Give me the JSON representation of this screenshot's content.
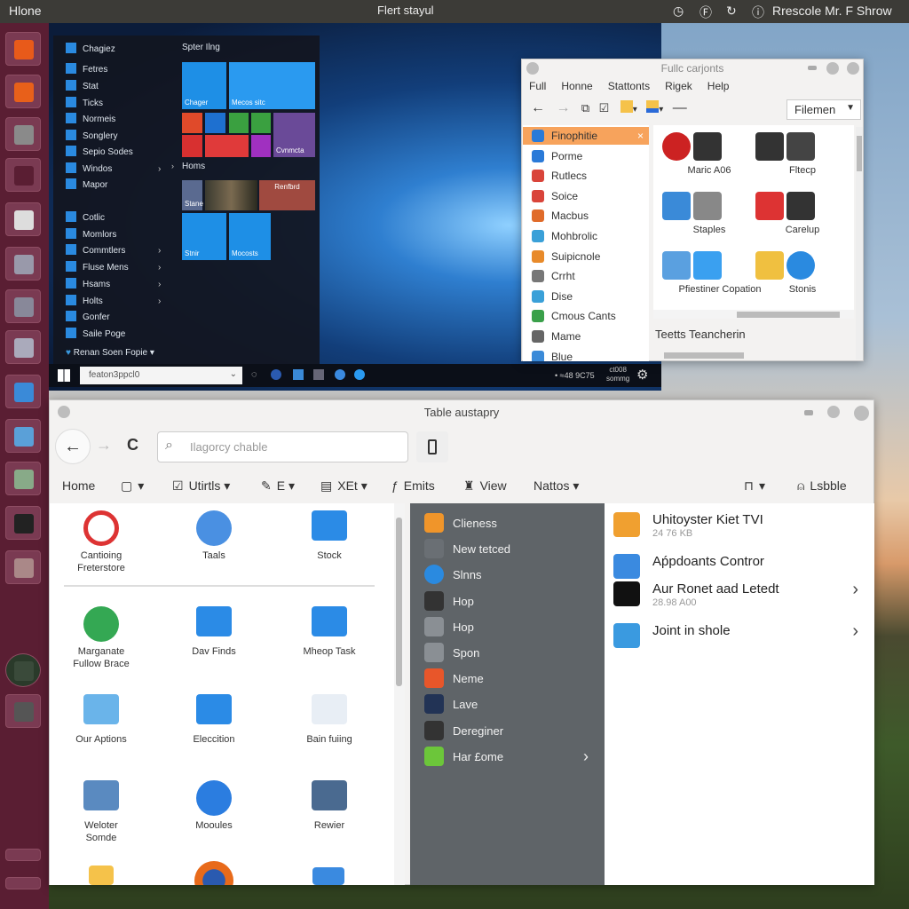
{
  "topbar": {
    "left": "Hlone",
    "center": "Flert stayul",
    "right": "Rrescole Mr. F Shrow",
    "icons": [
      "clock-icon",
      "f-icon",
      "refresh-icon",
      "info-icon"
    ]
  },
  "launcher": {
    "icons": [
      "settings-icon",
      "text-editor-icon",
      "search-icon",
      "flash-icon",
      "qr-icon",
      "cable-icon",
      "image-viewer-icon",
      "balloon-icon",
      "office-icon",
      "spreadsheet-icon",
      "disks-icon",
      "checkbox-icon",
      "network-icon",
      "clock-icon",
      "add-workspace-icon",
      "minimize-icon",
      "printer-icon"
    ]
  },
  "start_menu": {
    "items": [
      {
        "label": "Chagiez"
      },
      {
        "label": "Fetres"
      },
      {
        "label": "Stat"
      },
      {
        "label": "Ticks"
      },
      {
        "label": "Normeis"
      },
      {
        "label": "Songlery"
      },
      {
        "label": "Sepio Sodes"
      },
      {
        "label": "Windos",
        "arrow": true
      },
      {
        "label": "Mapor"
      },
      {
        "label": "Cotlic"
      },
      {
        "label": "Momlors"
      },
      {
        "label": "Commtlers",
        "arrow": true
      },
      {
        "label": "Fluse Mens",
        "arrow": true
      },
      {
        "label": "Hsams",
        "arrow": true
      },
      {
        "label": "Holts",
        "arrow": true
      },
      {
        "label": "Gonfer"
      },
      {
        "label": "Saile Poge"
      }
    ],
    "footer": "Renan Soen Fopie ▾",
    "group1": "Spter Ilng",
    "group2": "Homs",
    "tiles": [
      "Chager",
      "Mecos sitc",
      "Cvnmcta",
      "Stane",
      "Stnir",
      "Mocosts"
    ],
    "news_tile": "Renfbrd"
  },
  "taskbar": {
    "search": "featon3ppcl0",
    "tray_status": "• ≈48 9C75",
    "clock_top": "ct008",
    "clock_bottom": "sommg"
  },
  "file_window": {
    "title": "Fullc carjonts",
    "menu": [
      "Full",
      "Honne",
      "Stattonts",
      "Rigek",
      "Help"
    ],
    "dropdown": "Filemen",
    "sidebar": [
      {
        "label": "Finophitie",
        "color": "#2a7ad8"
      },
      {
        "label": "Porme",
        "color": "#2a7ad8"
      },
      {
        "label": "Rutlecs",
        "color": "#d9443a"
      },
      {
        "label": "Soice",
        "color": "#d9443a"
      },
      {
        "label": "Macbus",
        "color": "#e06b2a"
      },
      {
        "label": "Mohbrolic",
        "color": "#3aa0d8"
      },
      {
        "label": "Suipicnole",
        "color": "#e88a2a"
      },
      {
        "label": "Crrht",
        "color": "#777777"
      },
      {
        "label": "Dise",
        "color": "#3aa0d8"
      },
      {
        "label": "Cmous Cants",
        "color": "#3aa04a"
      },
      {
        "label": "Mame",
        "color": "#666666"
      },
      {
        "label": "Blue",
        "color": "#3a8ad8"
      }
    ],
    "selected_color": "#f7a35c",
    "grid": [
      "Maric A06",
      "Fltecp",
      "Staples",
      "Carelup",
      "Pfiestiner Copation",
      "Stonis"
    ],
    "footer": "Teetts Teancherin"
  },
  "main_window": {
    "title": "Table austapry",
    "search_placeholder": "Ilagorcy chable",
    "menu": [
      "Home",
      "▾",
      "Utirtls ▾",
      "E ▾",
      "XEt ▾",
      "Emits",
      "View",
      "Nattos ▾"
    ],
    "menu_right": [
      "▾",
      "Lsbble"
    ],
    "grid": [
      {
        "label": "Cantioing\nFreterstore",
        "color": "#d33"
      },
      {
        "label": "Taals",
        "color": "#4a90e2"
      },
      {
        "label": "Stock",
        "color": "#2b8be6"
      },
      {
        "label": "Marganate\nFullow Brace",
        "color": "#34a853"
      },
      {
        "label": "Dav Finds",
        "color": "#2b8be6"
      },
      {
        "label": "Mheop Task",
        "color": "#2b8be6"
      },
      {
        "label": "Our Aptions",
        "color": "#6ab4ea"
      },
      {
        "label": "Eleccition",
        "color": "#2b8be6"
      },
      {
        "label": "Bain fuiing",
        "color": "#e8eef5"
      },
      {
        "label": "Weloter\nSomde",
        "color": "#5a8ac0"
      },
      {
        "label": "Mooules",
        "color": "#2b7de0"
      },
      {
        "label": "Rewier",
        "color": "#4a6a90"
      }
    ],
    "panel": [
      {
        "label": "Clieness",
        "color": "#f0952a"
      },
      {
        "label": "New tetced",
        "color": "#6a6f74"
      },
      {
        "label": "Slnns",
        "color": "#2a8ae0"
      },
      {
        "label": "Hop",
        "color": "#333333"
      },
      {
        "label": "Hop",
        "color": "#8a8f94"
      },
      {
        "label": "Spon",
        "color": "#8a8f94"
      },
      {
        "label": "Neme",
        "color": "#e8562a"
      },
      {
        "label": "Lave",
        "color": "#223355"
      },
      {
        "label": "Dereginer",
        "color": "#333333"
      },
      {
        "label": "Har £ome",
        "color": "#6cc63a",
        "arrow": true
      }
    ],
    "panel_color": "#5f6468",
    "right": [
      {
        "title": "Uhitoyster Kiet TVI",
        "sub": "24 76 KB",
        "color": "#f0a030"
      },
      {
        "title": "Aṕpdoants Contror",
        "sub": "",
        "color": "#3a8ae0"
      },
      {
        "title": "Aur Ronet aad Letedt",
        "sub": "28.98 A00",
        "color": "#111111",
        "arrow": true
      },
      {
        "title": "Joint in shole",
        "sub": "",
        "color": "#3a9ae0",
        "arrow": true
      }
    ]
  }
}
